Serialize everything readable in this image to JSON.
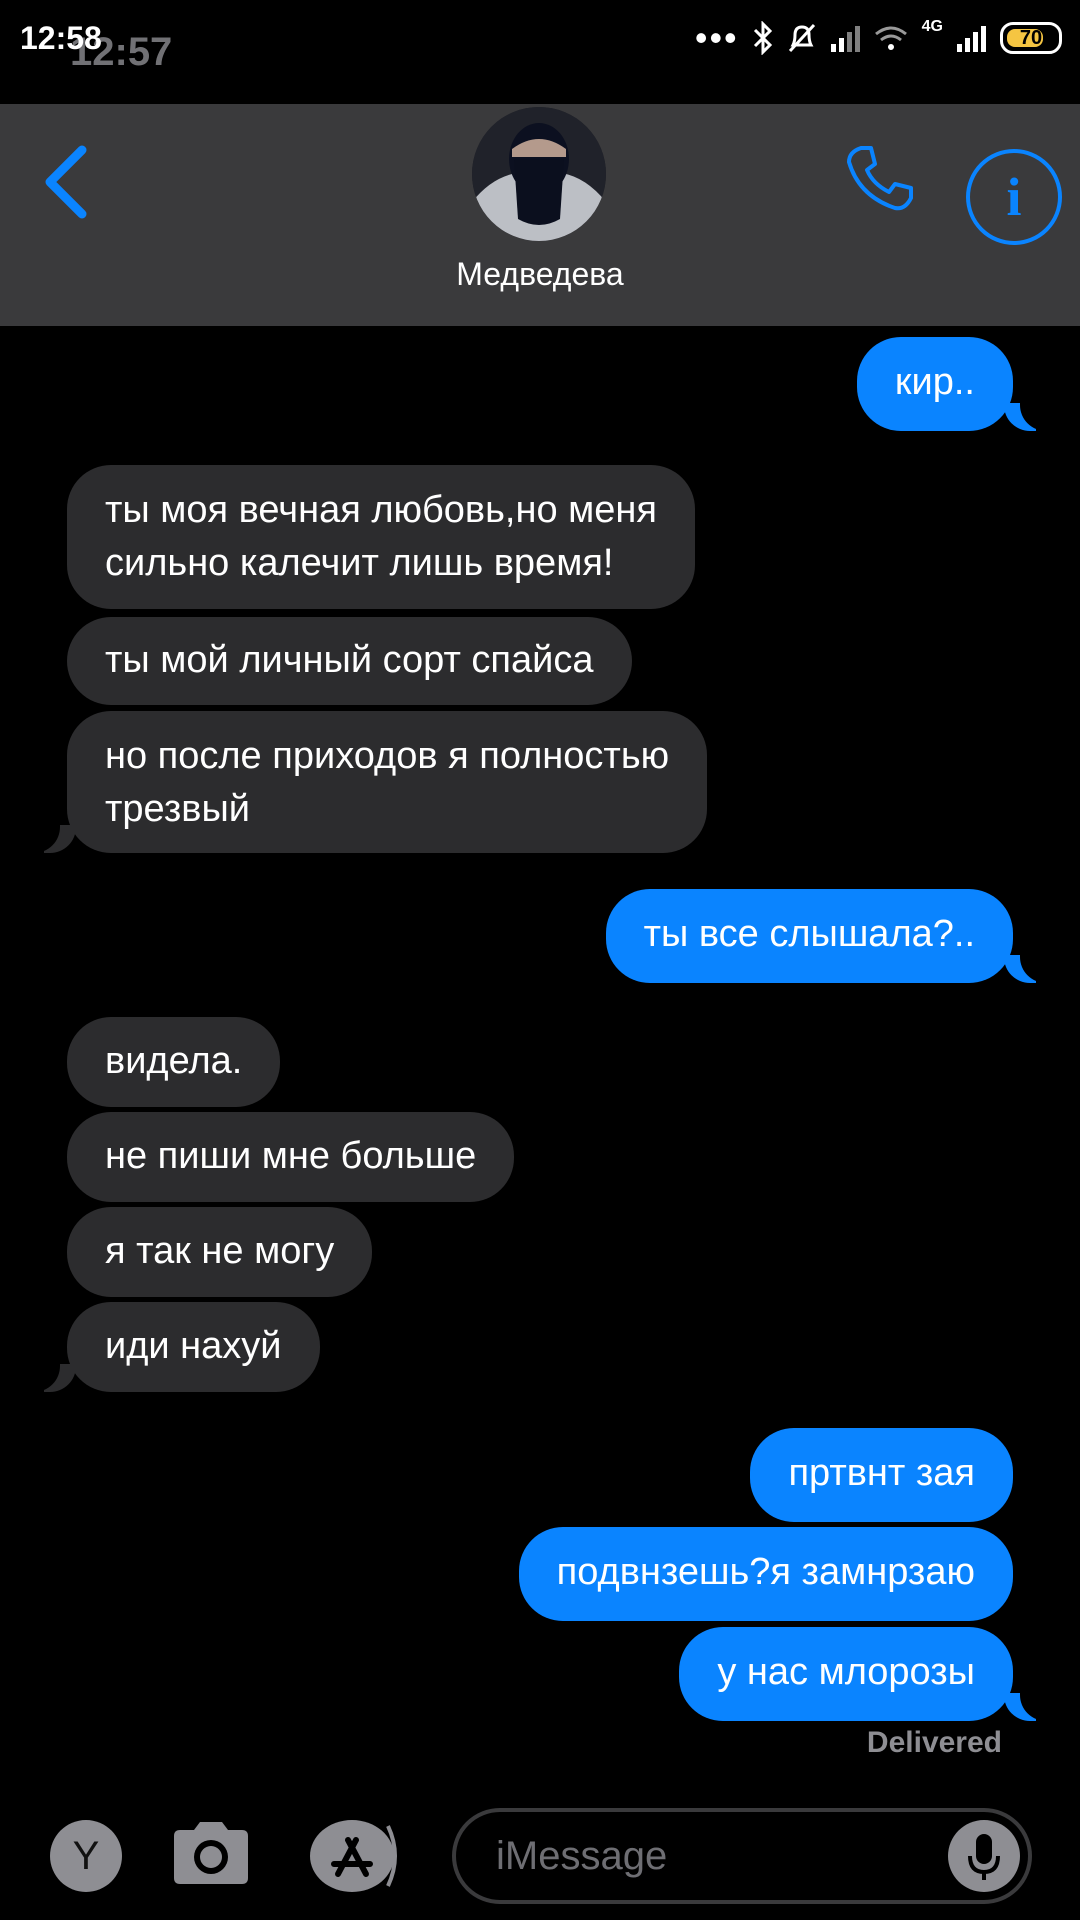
{
  "status_bar": {
    "time": "12:58",
    "ghost_time": "12:57",
    "network": "4G",
    "battery": "70"
  },
  "header": {
    "contact_name": "Медведева"
  },
  "messages": [
    {
      "dir": "out",
      "text": "кир.."
    },
    {
      "dir": "in",
      "text": "ты моя вечная любовь,но меня\nсильно калечит лишь время!"
    },
    {
      "dir": "in",
      "text": "ты мой личный сорт спайса"
    },
    {
      "dir": "in",
      "text": "но после приходов я полностью\nтрезвый"
    },
    {
      "dir": "out",
      "text": "ты все слышала?.."
    },
    {
      "dir": "in",
      "text": "видела."
    },
    {
      "dir": "in",
      "text": "не пиши мне больше"
    },
    {
      "dir": "in",
      "text": "я так не могу"
    },
    {
      "dir": "in",
      "text": "иди нахуй"
    },
    {
      "dir": "out",
      "text": "пртвнт зая"
    },
    {
      "dir": "out",
      "text": "подвнзешь?я замнрзаю"
    },
    {
      "dir": "out",
      "text": "у нас млорозы"
    }
  ],
  "delivered_label": "Delivered",
  "composer": {
    "placeholder": "iMessage",
    "app_button_label": "Y"
  },
  "colors": {
    "accent": "#0a84ff",
    "incoming_bubble": "#2c2c2e",
    "header_bg": "#3a3a3c"
  }
}
